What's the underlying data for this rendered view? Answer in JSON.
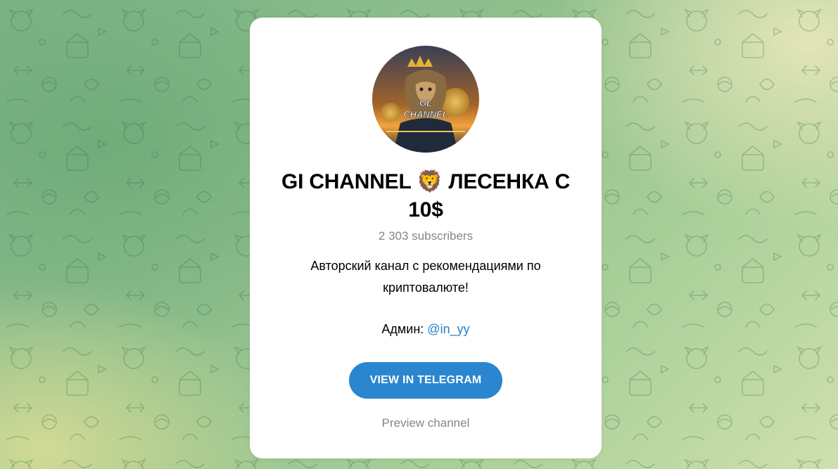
{
  "channel": {
    "title": "GI CHANNEL 🦁 ЛЕСЕНКА С 10$",
    "avatar_text": "GL CHANNEL",
    "subscribers": "2 303 subscribers",
    "description": "Авторский канал с рекомендациями по криптовалюте!",
    "admin_label": "Админ:",
    "admin_handle": "@in_yy"
  },
  "actions": {
    "view_button": "VIEW IN TELEGRAM",
    "preview_link": "Preview channel"
  },
  "colors": {
    "button": "#2a86cf",
    "link": "#2481cc",
    "muted": "#858585",
    "background_green": "#8fbf8c"
  }
}
